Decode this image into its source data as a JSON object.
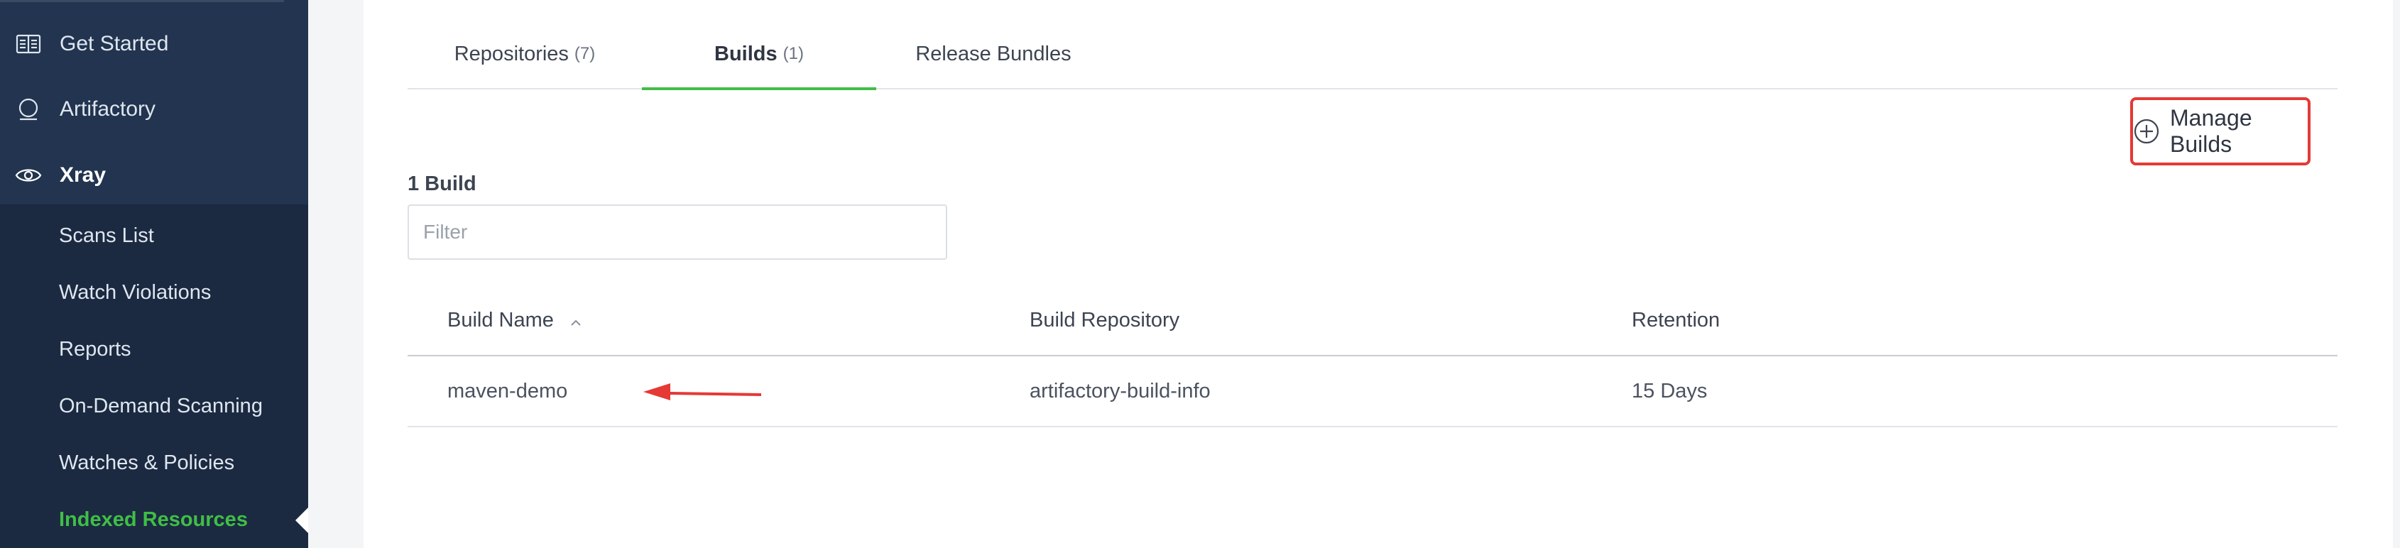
{
  "sidebar": {
    "items": [
      {
        "label": "Get Started",
        "icon": "book-icon"
      },
      {
        "label": "Artifactory",
        "icon": "artifactory-icon"
      },
      {
        "label": "Xray",
        "icon": "eye-icon"
      }
    ],
    "xray_sub_items": [
      {
        "label": "Scans List"
      },
      {
        "label": "Watch Violations"
      },
      {
        "label": "Reports"
      },
      {
        "label": "On-Demand Scanning"
      },
      {
        "label": "Watches & Policies"
      },
      {
        "label": "Indexed Resources",
        "active": true
      }
    ]
  },
  "tabs": [
    {
      "label": "Repositories",
      "count": "(7)"
    },
    {
      "label": "Builds",
      "count": "(1)",
      "active": true
    },
    {
      "label": "Release Bundles",
      "count": ""
    }
  ],
  "toolbar": {
    "manage_builds_label": "Manage Builds"
  },
  "builds": {
    "count_label": "1 Build",
    "filter_placeholder": "Filter",
    "columns": [
      "Build Name",
      "Build Repository",
      "Retention"
    ],
    "rows": [
      {
        "name": "maven-demo",
        "repository": "artifactory-build-info",
        "retention": "15 Days"
      }
    ]
  },
  "colors": {
    "accent_green": "#40be46",
    "sidebar_bg": "#1b2a41",
    "highlight_red": "#e53935"
  }
}
